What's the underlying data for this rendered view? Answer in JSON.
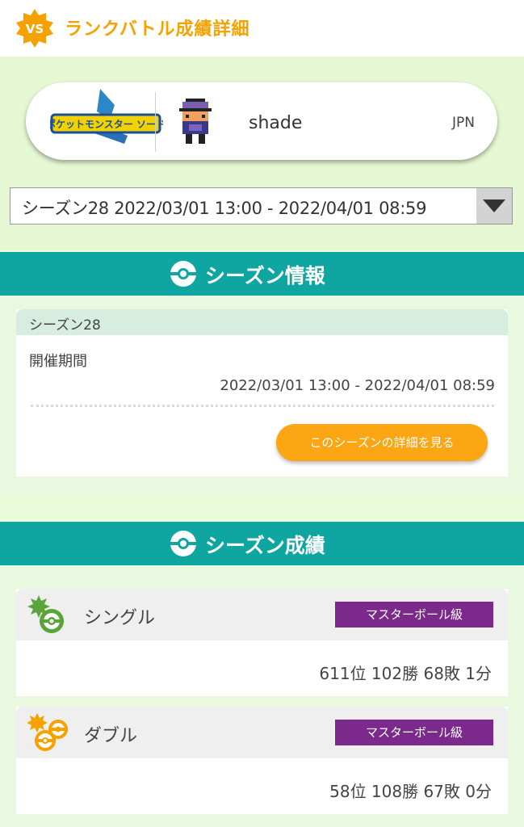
{
  "header": {
    "title": "ランクバトル成績詳細",
    "badge": "VS"
  },
  "player": {
    "name": "shade",
    "region": "JPN",
    "game_logo": "ポケットモンスター ソード"
  },
  "season_select": {
    "value": "シーズン28 2022/03/01 13:00 - 2022/04/01 08:59"
  },
  "season_info": {
    "section_title": "シーズン情報",
    "season_name": "シーズン28",
    "period_label": "開催期間",
    "period_value": "2022/03/01 13:00 - 2022/04/01 08:59",
    "detail_button": "このシーズンの詳細を見る"
  },
  "season_results": {
    "section_title": "シーズン成績",
    "single": {
      "label": "シングル",
      "rank_class": "マスターボール級",
      "stats": "611位 102勝 68敗 1分"
    },
    "double": {
      "label": "ダブル",
      "rank_class": "マスターボール級",
      "stats": "58位 108勝 67敗 0分"
    }
  },
  "colors": {
    "accent": "#f5a100",
    "teal": "#0fa5a0",
    "master": "#7b2a8c",
    "button": "#fba612",
    "single_icon": "#5aa53a"
  }
}
